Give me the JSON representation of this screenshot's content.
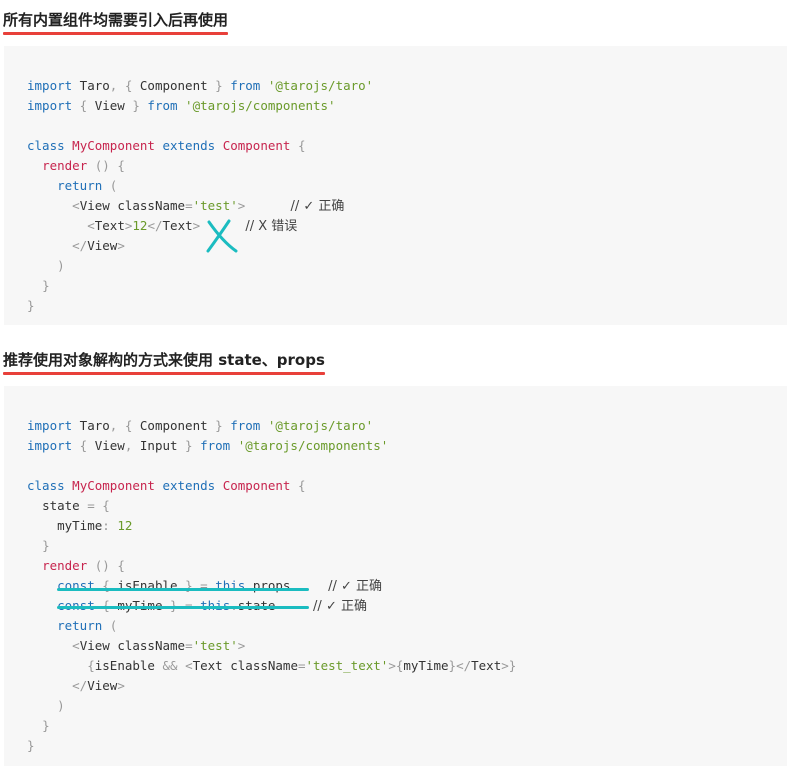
{
  "section1": {
    "heading": "所有内置组件均需要引入后再使用",
    "code": {
      "l1": {
        "kw1": "import",
        "a": " Taro",
        "p1": ",",
        "b": " { ",
        "c": "Component",
        "d": " } ",
        "kw2": "from",
        "s": " '@tarojs/taro'"
      },
      "l2": {
        "kw1": "import",
        "b": " { ",
        "c": "View",
        "d": " } ",
        "kw2": "from",
        "s": " '@tarojs/components'"
      },
      "l4": {
        "kw1": "class",
        "cls": " MyComponent",
        "kw2": " extends",
        "cls2": " Component",
        "p": " {"
      },
      "l5": {
        "m": "render",
        "p": " () {"
      },
      "l6": {
        "kw": "return",
        "p": " ("
      },
      "l7": {
        "t1": "<",
        "tag": "View",
        "attr": " className",
        "eq": "=",
        "s": "'test'",
        "t2": ">",
        "cmt": "// ✓ 正确"
      },
      "l8": {
        "t1": "<",
        "tag": "Text",
        "t2": ">",
        "num": "12",
        "t3": "</",
        "tag2": "Text",
        "t4": ">",
        "cmt": "// X 错误"
      },
      "l9": {
        "t1": "</",
        "tag": "View",
        "t2": ">"
      },
      "l10": ")",
      "l11": "}",
      "l12": "}"
    }
  },
  "section2": {
    "heading": "推荐使用对象解构的方式来使用 state、props",
    "code": {
      "l1": {
        "kw1": "import",
        "a": " Taro",
        "p1": ",",
        "b": " { ",
        "c": "Component",
        "d": " } ",
        "kw2": "from",
        "s": " '@tarojs/taro'"
      },
      "l2": {
        "kw1": "import",
        "b": " { ",
        "c": "View",
        "p1": ",",
        "c2": " Input",
        "d": " } ",
        "kw2": "from",
        "s": " '@tarojs/components'"
      },
      "l4": {
        "kw1": "class",
        "cls": " MyComponent",
        "kw2": " extends",
        "cls2": " Component",
        "p": " {"
      },
      "l5": {
        "id": "state",
        "p": " = {"
      },
      "l6": {
        "id": "myTime",
        "p": ": ",
        "num": "12"
      },
      "l7": "}",
      "l8": {
        "m": "render",
        "p": " () {"
      },
      "l9": {
        "kw": "const",
        "p1": " { ",
        "id": "isEnable",
        "p2": " } = ",
        "kw2": "this",
        "p3": ".",
        "id2": "props",
        "cmt": "// ✓ 正确"
      },
      "l10": {
        "kw": "const",
        "p1": " { ",
        "id": "myTime",
        "p2": " } = ",
        "kw2": "this",
        "p3": ".",
        "id2": "state",
        "cmt": "// ✓ 正确"
      },
      "l11": {
        "kw": "return",
        "p": " ("
      },
      "l12": {
        "t1": "<",
        "tag": "View",
        "attr": " className",
        "eq": "=",
        "s": "'test'",
        "t2": ">"
      },
      "l13": {
        "b1": "{",
        "id": "isEnable",
        "op": " && ",
        "t1": "<",
        "tag": "Text",
        "attr": " className",
        "eq": "=",
        "s": "'test_text'",
        "t2": ">",
        "b2": "{",
        "id2": "myTime",
        "b3": "}",
        "t3": "</",
        "tag2": "Text",
        "t4": ">",
        "b4": "}"
      },
      "l14": {
        "t1": "</",
        "tag": "View",
        "t2": ">"
      },
      "l15": ")",
      "l16": "}",
      "l17": "}"
    }
  },
  "annotations": {
    "accent": "#1bbcc0",
    "heading_underline": "#e8403a"
  }
}
